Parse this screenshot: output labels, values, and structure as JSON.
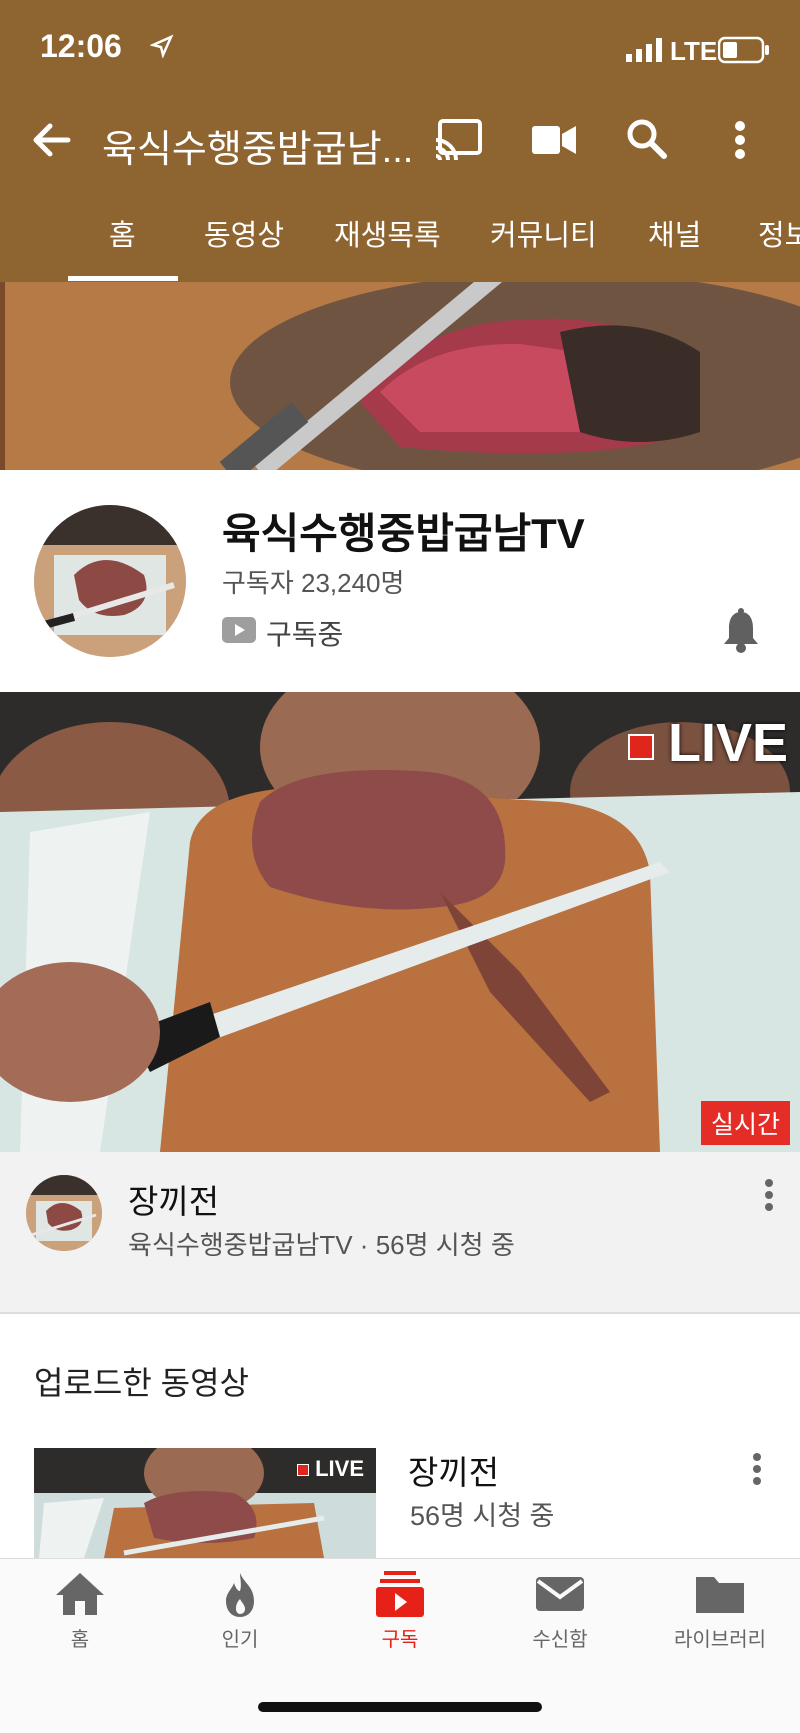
{
  "status_bar": {
    "time": "12:06",
    "network": "LTE"
  },
  "header": {
    "channel_title": "육식수행중밥굽남...",
    "tabs": [
      "홈",
      "동영상",
      "재생목록",
      "커뮤니티",
      "채널",
      "정보"
    ],
    "active_tab": "홈"
  },
  "channel": {
    "name": "육식수행중밥굽남TV",
    "subscribers": "구독자 23,240명",
    "subscribe_state": "구독중"
  },
  "featured": {
    "live_label": "LIVE",
    "realtime_badge": "실시간",
    "title": "장끼전",
    "meta": "육식수행중밥굽남TV · 56명 시청 중"
  },
  "uploads": {
    "section_title": "업로드한 동영상",
    "items": [
      {
        "title": "장끼전",
        "meta": "56명 시청 중",
        "live_label": "LIVE"
      }
    ]
  },
  "bottom_nav": {
    "items": [
      {
        "label": "홈",
        "icon": "home-icon"
      },
      {
        "label": "인기",
        "icon": "flame-icon"
      },
      {
        "label": "구독",
        "icon": "subscriptions-icon"
      },
      {
        "label": "수신함",
        "icon": "inbox-icon"
      },
      {
        "label": "라이브러리",
        "icon": "library-icon"
      }
    ],
    "active": "구독"
  },
  "colors": {
    "header_bg": "#8e6430",
    "accent_red": "#e62117"
  }
}
